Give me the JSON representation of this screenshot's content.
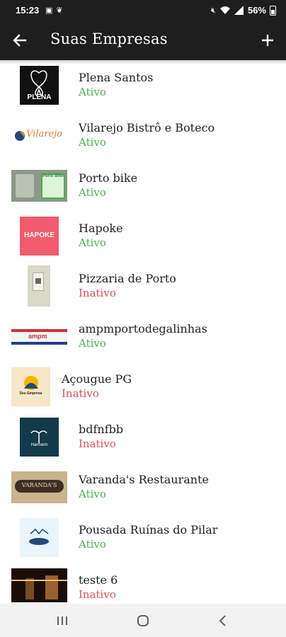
{
  "status_bar": {
    "time": "15:23",
    "battery": "56%"
  },
  "header": {
    "title": "Suas Empresas",
    "back_icon": "arrow-left-icon",
    "add_icon": "plus-icon"
  },
  "colors": {
    "appbar": "#1e1e1e",
    "active": "#4caf50",
    "inactive": "#e05050"
  },
  "companies": [
    {
      "name": "Plena Santos",
      "status": "Ativo",
      "logo_text": "PLENA"
    },
    {
      "name": "Vilarejo Bistrô e Boteco",
      "status": "Ativo",
      "logo_text": "Vilarejo"
    },
    {
      "name": "Porto bike",
      "status": "Ativo",
      "logo_text": "Porto Bike"
    },
    {
      "name": "Hapoke",
      "status": "Ativo",
      "logo_text": "HAPOKE"
    },
    {
      "name": "Pizzaria de Porto",
      "status": "Inativo"
    },
    {
      "name": "ampmportodegalinhas",
      "status": "Ativo",
      "logo_text": "ampm"
    },
    {
      "name": "Açougue PG",
      "status": "Inativo",
      "logo_text": "Seu Empresa"
    },
    {
      "name": "bdfnfbb",
      "status": "Inativo",
      "logo_text": "Hanheim"
    },
    {
      "name": "Varanda's Restaurante",
      "status": "Ativo",
      "logo_text": "VARANDA'S"
    },
    {
      "name": "Pousada Ruínas do Pilar",
      "status": "Ativo"
    },
    {
      "name": "teste 6",
      "status": "Inativo"
    }
  ],
  "nav_bar": {
    "recent_icon": "recent-apps-icon",
    "home_icon": "home-icon",
    "back_icon": "back-chevron-icon"
  }
}
